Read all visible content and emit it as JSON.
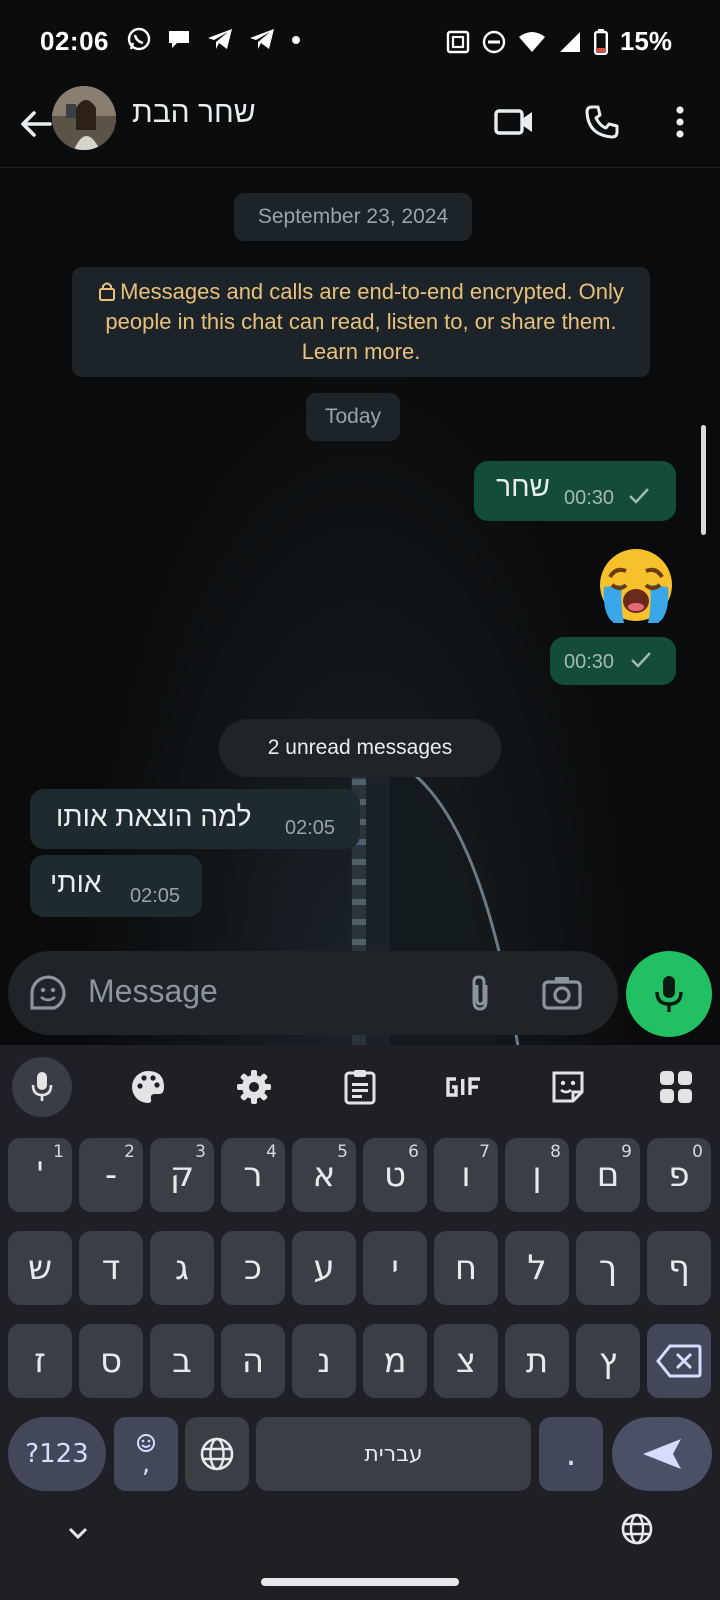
{
  "status_bar": {
    "time": "02:06",
    "battery": "15%",
    "left_icons": [
      "whatsapp-icon",
      "chat-icon",
      "telegram-icon",
      "telegram-icon",
      "dot-icon"
    ],
    "right_icons": [
      "nfc-icon",
      "dnd-icon",
      "wifi-icon",
      "signal-icon",
      "battery-icon"
    ]
  },
  "header": {
    "contact_name": "שחר הבת"
  },
  "chat": {
    "date_pill": "September 23, 2024",
    "encryption_notice": "Messages and calls are end-to-end encrypted. Only people in this chat can read, listen to, or share them. Learn more.",
    "today_pill": "Today",
    "messages_out": [
      {
        "text": "שחר",
        "time": "00:30"
      },
      {
        "text": "😭",
        "time": "00:30"
      }
    ],
    "unread_label": "2 unread messages",
    "messages_in": [
      {
        "text": "למה הוצאת אותו",
        "time": "02:05"
      },
      {
        "text": "אותי",
        "time": "02:05"
      }
    ]
  },
  "composer": {
    "placeholder": "Message"
  },
  "keyboard": {
    "row1": [
      {
        "k": "'",
        "h": "1"
      },
      {
        "k": "-",
        "h": "2"
      },
      {
        "k": "ק",
        "h": "3"
      },
      {
        "k": "ר",
        "h": "4"
      },
      {
        "k": "א",
        "h": "5"
      },
      {
        "k": "ט",
        "h": "6"
      },
      {
        "k": "ו",
        "h": "7"
      },
      {
        "k": "ן",
        "h": "8"
      },
      {
        "k": "ם",
        "h": "9"
      },
      {
        "k": "פ",
        "h": "0"
      }
    ],
    "row2": [
      "ש",
      "ד",
      "ג",
      "כ",
      "ע",
      "י",
      "ח",
      "ל",
      "ך",
      "ף"
    ],
    "row3": [
      "ז",
      "ס",
      "ב",
      "ה",
      "נ",
      "מ",
      "צ",
      "ת",
      "ץ"
    ],
    "symbols_key": "?123",
    "emoji_comma_key": ",",
    "space_label": "עברית",
    "period_key": "."
  },
  "colors": {
    "outgoing_bubble": "#134d37",
    "incoming_bubble": "#1f2a30",
    "mic_fab": "#21c063",
    "encryption_text": "#e8c07a"
  }
}
